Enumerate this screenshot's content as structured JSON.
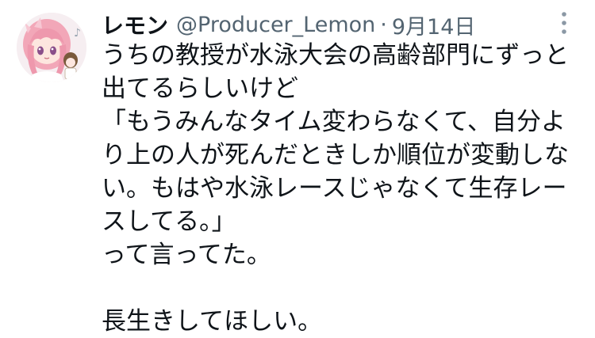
{
  "tweet": {
    "author": {
      "display_name": "レモン",
      "handle": "@Producer_Lemon",
      "avatar_icon": "anime-girl-avatar-icon"
    },
    "separator": "·",
    "date": "9月14日",
    "more_icon": "more-vertical-icon",
    "text": "うちの教授が水泳大会の高齢部門にずっと\n出てるらしいけど\n「もうみんなタイム変わらなくて、自分よ\nり上の人が死んだときしか順位が変動しな\nい。もはや水泳レースじゃなくて生存レー\nスしてる。」\nって言ってた。\n\n長生きしてほしい。"
  },
  "colors": {
    "text": "#0f1419",
    "secondary_text": "#536471",
    "background": "#ffffff"
  }
}
